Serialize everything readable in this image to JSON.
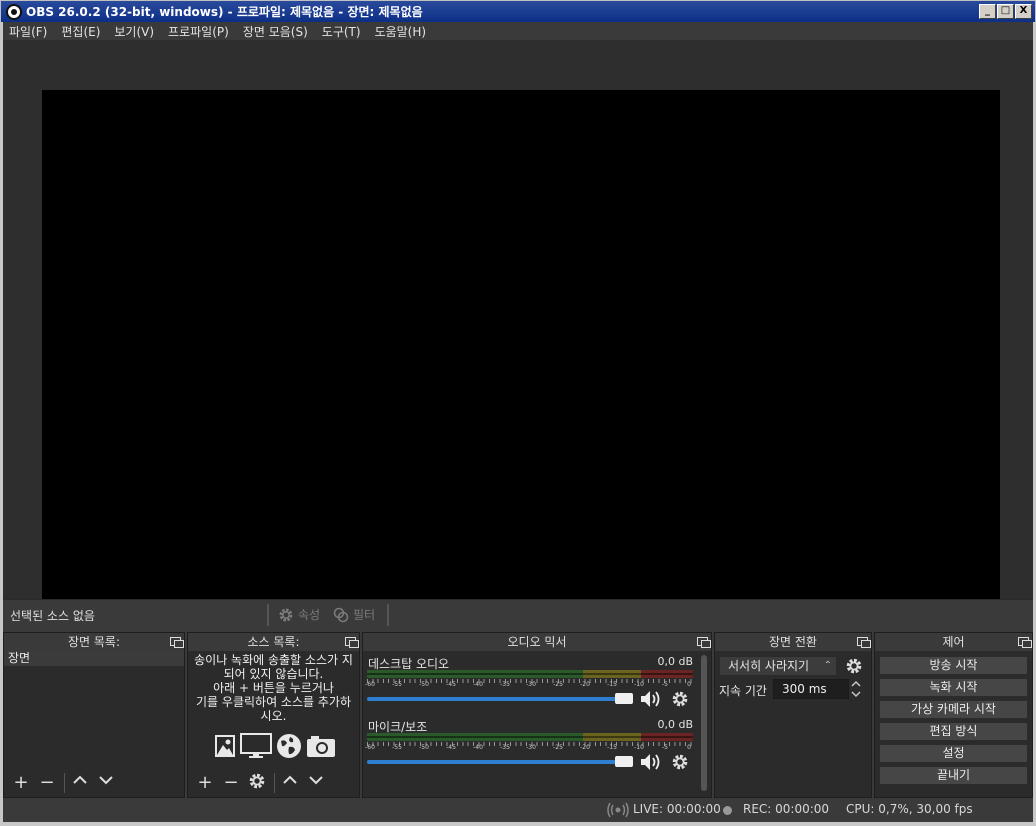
{
  "window": {
    "title": "OBS 26.0.2 (32-bit, windows) - 프로파일: 제목없음 - 장면: 제목없음",
    "minimize": "_",
    "maximize": "□",
    "close": "X"
  },
  "menu": [
    "파일(F)",
    "편집(E)",
    "보기(V)",
    "프로파일(P)",
    "장면 모음(S)",
    "도구(T)",
    "도움말(H)"
  ],
  "source_toolbar": {
    "no_selection": "선택된 소스 없음",
    "properties": "속성",
    "filters": "필터"
  },
  "scenes": {
    "title": "장면 목록:",
    "items": [
      "장면"
    ]
  },
  "sources": {
    "title": "소스 목록:",
    "empty_message": "송이나 녹화에 송출할 소스가 지\n되어 있지 않습니다.\n아래 + 버튼을 누르거나\n기를 우클릭하여 소스를 추가하\n시오."
  },
  "mixer": {
    "title": "오디오 믹서",
    "scale": [
      "-60",
      "-55",
      "-50",
      "-45",
      "-40",
      "-35",
      "-30",
      "-25",
      "-20",
      "-15",
      "-10",
      "-5",
      "0"
    ],
    "channels": [
      {
        "name": "데스크탑 오디오",
        "level": "0,0 dB",
        "volume": 1.0
      },
      {
        "name": "마이크/보조",
        "level": "0,0 dB",
        "volume": 1.0
      }
    ]
  },
  "transitions": {
    "title": "장면 전환",
    "selected": "서서히 사라지기",
    "duration_label": "지속 기간",
    "duration_value": "300 ms"
  },
  "controls": {
    "title": "제어",
    "buttons": [
      "방송 시작",
      "녹화 시작",
      "가상 카메라 시작",
      "편집 방식",
      "설정",
      "끝내기"
    ]
  },
  "status": {
    "live": "LIVE: 00:00:00",
    "rec": "REC: 00:00:00",
    "cpu": "CPU: 0,7%, 30,00 fps"
  },
  "colors": {
    "meter_green": "#2a5a2a",
    "meter_yellow": "#6a6420",
    "meter_red": "#6a2424",
    "volume_blue": "#2f7fd0"
  }
}
